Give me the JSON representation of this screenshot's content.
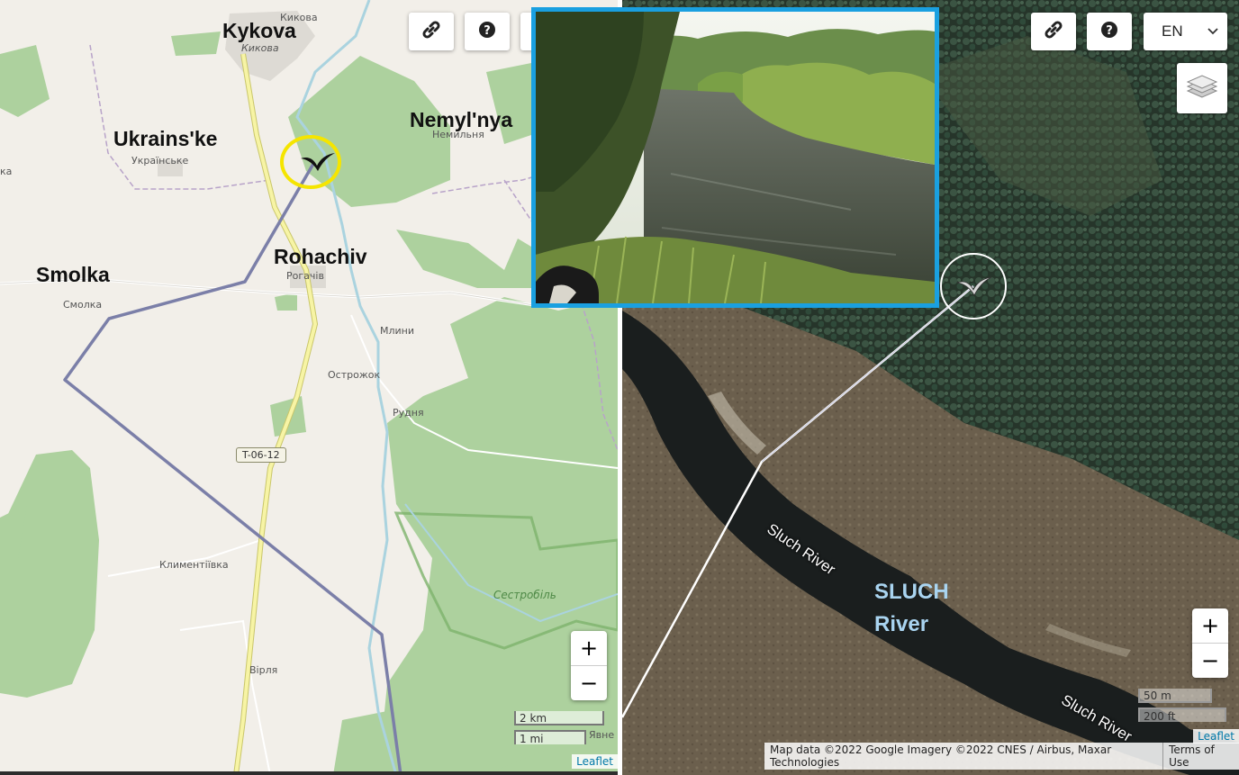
{
  "left_map": {
    "labels": {
      "kykova": "Kykova",
      "ukrainske": "Ukrains'ke",
      "nemylnya": "Nemyl'nya",
      "rohachiv": "Rohachiv",
      "smolka": "Smolka"
    },
    "small_labels": {
      "kykova_cyr": "Кикова",
      "kykova_cyr2": "Кикова",
      "ukrainske_cyr": "Українське",
      "nemylnya_cyr": "Немильня",
      "rohachiv_cyr": "Рогачів",
      "smolka_cyr": "Смолка",
      "mlyny": "Млини",
      "ostrozhok": "Острожок",
      "rudnia": "Рудня",
      "klymentiivka": "Климентіївка",
      "sestrobil": "Сестробіль",
      "virlia": "Вірля",
      "yavne": "Явне",
      "edge_ka": "ка"
    },
    "road_label": "T-06-12",
    "zoom_in": "+",
    "zoom_out": "−",
    "scale_km": "2 km",
    "scale_mi": "1 mi",
    "attribution": "Leaflet"
  },
  "right_map": {
    "language": "EN",
    "river_labels": {
      "upper": "Sluch River",
      "lower": "Sluch River"
    },
    "big_label_line1": "SLUCH",
    "big_label_line2": "River",
    "zoom_in": "+",
    "zoom_out": "−",
    "scale_m": "50 m",
    "scale_ft": "200 ft",
    "leaflet": "Leaflet",
    "attribution": "Map data ©2022 Google Imagery ©2022 CNES / Airbus, Maxar Technologies",
    "terms": "Terms of Use"
  },
  "icons": {
    "link": "link-icon",
    "help": "question-circle-icon",
    "layers": "layers-icon",
    "chevron": "chevron-down-icon",
    "marker": "bird-wing-marker-icon"
  },
  "colors": {
    "highlight_ring": "#f5e500",
    "photo_border": "#1aa0e0",
    "route_line": "#7b7fa8",
    "forest": "#a8d495"
  }
}
